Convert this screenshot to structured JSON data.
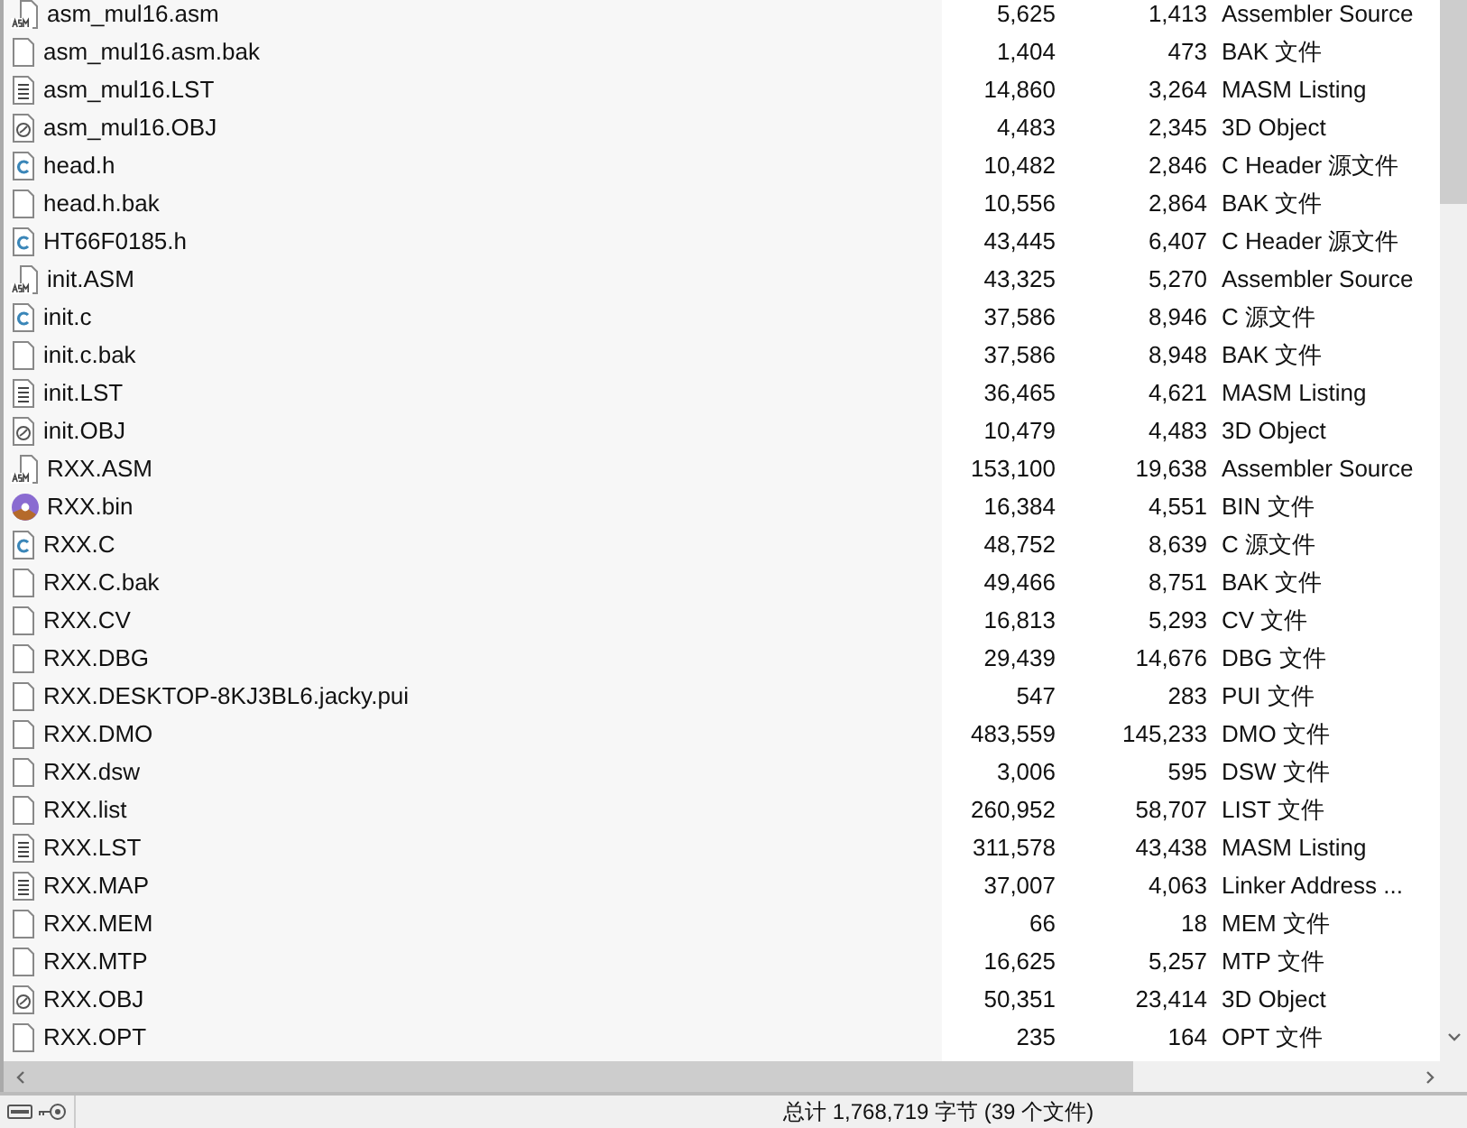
{
  "files": [
    {
      "kind": "asm",
      "name": "asm_mul16.asm",
      "size": "5,625",
      "packed": "1,413",
      "type": "Assembler Source"
    },
    {
      "kind": "blank",
      "name": "asm_mul16.asm.bak",
      "size": "1,404",
      "packed": "473",
      "type": "BAK 文件"
    },
    {
      "kind": "list",
      "name": "asm_mul16.LST",
      "size": "14,860",
      "packed": "3,264",
      "type": "MASM Listing"
    },
    {
      "kind": "obj",
      "name": "asm_mul16.OBJ",
      "size": "4,483",
      "packed": "2,345",
      "type": "3D Object"
    },
    {
      "kind": "c",
      "name": "head.h",
      "size": "10,482",
      "packed": "2,846",
      "type": "C Header 源文件"
    },
    {
      "kind": "blank",
      "name": "head.h.bak",
      "size": "10,556",
      "packed": "2,864",
      "type": "BAK 文件"
    },
    {
      "kind": "c",
      "name": "HT66F0185.h",
      "size": "43,445",
      "packed": "6,407",
      "type": "C Header 源文件"
    },
    {
      "kind": "asm",
      "name": "init.ASM",
      "size": "43,325",
      "packed": "5,270",
      "type": "Assembler Source"
    },
    {
      "kind": "c",
      "name": "init.c",
      "size": "37,586",
      "packed": "8,946",
      "type": "C 源文件"
    },
    {
      "kind": "blank",
      "name": "init.c.bak",
      "size": "37,586",
      "packed": "8,948",
      "type": "BAK 文件"
    },
    {
      "kind": "list",
      "name": "init.LST",
      "size": "36,465",
      "packed": "4,621",
      "type": "MASM Listing"
    },
    {
      "kind": "obj",
      "name": "init.OBJ",
      "size": "10,479",
      "packed": "4,483",
      "type": "3D Object"
    },
    {
      "kind": "asm",
      "name": "RXX.ASM",
      "size": "153,100",
      "packed": "19,638",
      "type": "Assembler Source"
    },
    {
      "kind": "bin",
      "name": "RXX.bin",
      "size": "16,384",
      "packed": "4,551",
      "type": "BIN 文件"
    },
    {
      "kind": "c",
      "name": "RXX.C",
      "size": "48,752",
      "packed": "8,639",
      "type": "C 源文件"
    },
    {
      "kind": "blank",
      "name": "RXX.C.bak",
      "size": "49,466",
      "packed": "8,751",
      "type": "BAK 文件"
    },
    {
      "kind": "blank",
      "name": "RXX.CV",
      "size": "16,813",
      "packed": "5,293",
      "type": "CV 文件"
    },
    {
      "kind": "blank",
      "name": "RXX.DBG",
      "size": "29,439",
      "packed": "14,676",
      "type": "DBG 文件"
    },
    {
      "kind": "blank",
      "name": "RXX.DESKTOP-8KJ3BL6.jacky.pui",
      "size": "547",
      "packed": "283",
      "type": "PUI 文件"
    },
    {
      "kind": "blank",
      "name": "RXX.DMO",
      "size": "483,559",
      "packed": "145,233",
      "type": "DMO 文件"
    },
    {
      "kind": "blank",
      "name": "RXX.dsw",
      "size": "3,006",
      "packed": "595",
      "type": "DSW 文件"
    },
    {
      "kind": "blank",
      "name": "RXX.list",
      "size": "260,952",
      "packed": "58,707",
      "type": "LIST 文件"
    },
    {
      "kind": "list",
      "name": "RXX.LST",
      "size": "311,578",
      "packed": "43,438",
      "type": "MASM Listing"
    },
    {
      "kind": "list",
      "name": "RXX.MAP",
      "size": "37,007",
      "packed": "4,063",
      "type": "Linker Address ..."
    },
    {
      "kind": "blank",
      "name": "RXX.MEM",
      "size": "66",
      "packed": "18",
      "type": "MEM 文件"
    },
    {
      "kind": "blank",
      "name": "RXX.MTP",
      "size": "16,625",
      "packed": "5,257",
      "type": "MTP 文件"
    },
    {
      "kind": "obj",
      "name": "RXX.OBJ",
      "size": "50,351",
      "packed": "23,414",
      "type": "3D Object"
    },
    {
      "kind": "blank",
      "name": "RXX.OPT",
      "size": "235",
      "packed": "164",
      "type": "OPT 文件"
    }
  ],
  "status_bar": {
    "total": "总计 1,768,719 字节 (39 个文件)"
  }
}
